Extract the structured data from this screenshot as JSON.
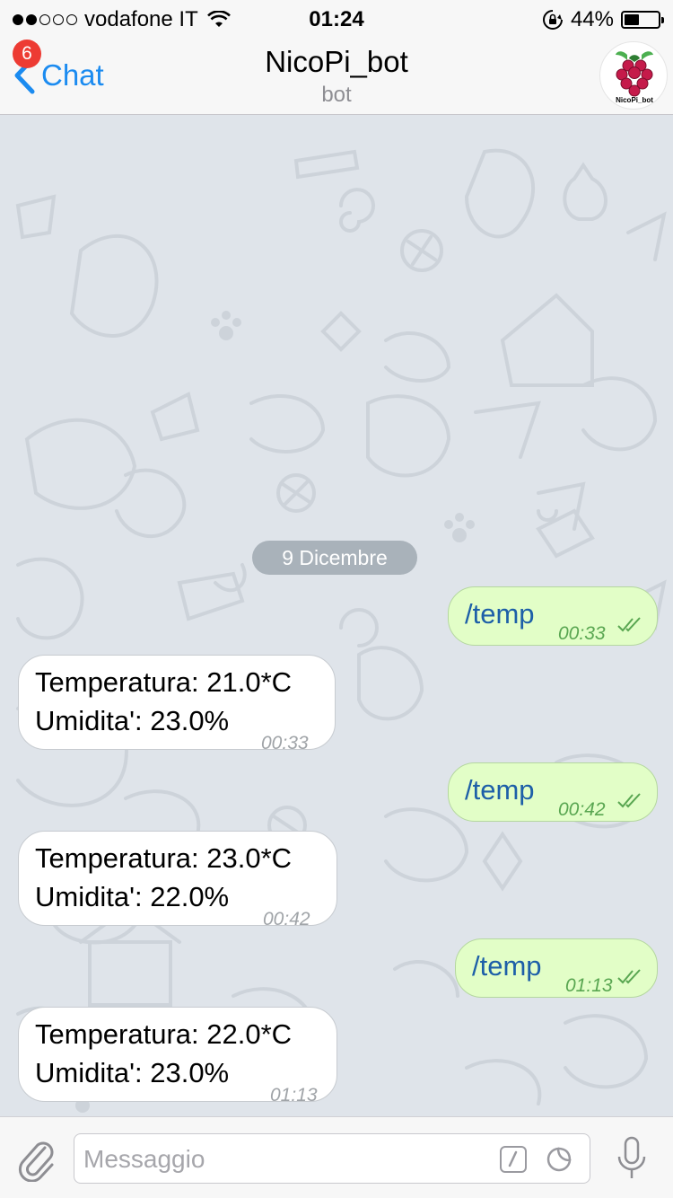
{
  "status_bar": {
    "carrier": "vodafone IT",
    "time": "01:24",
    "battery": "44%",
    "battery_level": 0.44,
    "icons": [
      "signal-dots-icon",
      "wifi-icon",
      "orientation-lock-icon",
      "battery-icon"
    ]
  },
  "nav": {
    "back_label": "Chat",
    "unread_badge": "6",
    "title": "NicoPi_bot",
    "subtitle": "bot",
    "avatar_caption": "NicoPi_bot",
    "link_color": "#1b8bf0"
  },
  "chat": {
    "date_label": "9 Dicembre",
    "messages": [
      {
        "dir": "out",
        "text": "/temp",
        "time": "00:33"
      },
      {
        "dir": "in",
        "text": "Temperatura: 21.0*C\nUmidita': 23.0%",
        "time": "00:33"
      },
      {
        "dir": "out",
        "text": "/temp",
        "time": "00:42"
      },
      {
        "dir": "in",
        "text": "Temperatura: 23.0*C\nUmidita': 22.0%",
        "time": "00:42"
      },
      {
        "dir": "out",
        "text": "/temp",
        "time": "01:13"
      },
      {
        "dir": "in",
        "text": "Temperatura: 22.0*C\nUmidita': 23.0%",
        "time": "01:13"
      }
    ],
    "colors": {
      "outgoing_bubble": "#e2fec7",
      "incoming_bubble": "#ffffff",
      "background": "#dfe4ea"
    }
  },
  "input": {
    "placeholder": "Messaggio",
    "icons": [
      "paperclip-icon",
      "bot-command-icon",
      "sticker-icon",
      "microphone-icon"
    ]
  }
}
